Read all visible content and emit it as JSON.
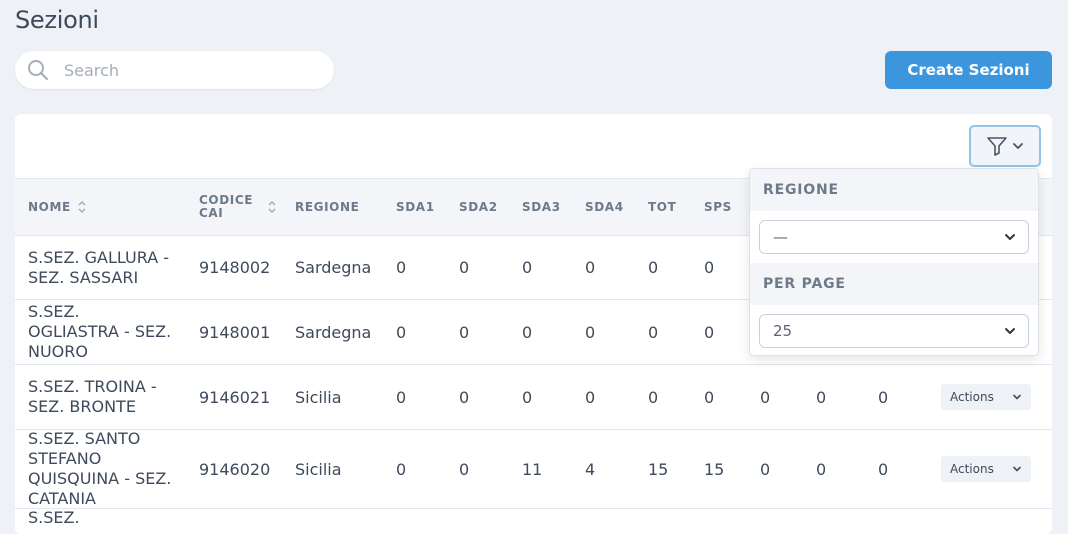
{
  "page": {
    "title": "Sezioni"
  },
  "search": {
    "placeholder": "Search",
    "value": ""
  },
  "toolbar": {
    "create_label": "Create Sezioni"
  },
  "table": {
    "columns": [
      "NOME",
      "CODICE CAI",
      "REGIONE",
      "SDA1",
      "SDA2",
      "SDA3",
      "SDA4",
      "TOT",
      "SPS"
    ],
    "codice_lines": [
      "CODICE",
      "CAI"
    ],
    "rows": [
      {
        "nome_lines": [
          "S.SEZ. GALLURA -",
          "SEZ. SASSARI"
        ],
        "codice": "9148002",
        "regione": "Sardegna",
        "sda1": "0",
        "sda2": "0",
        "sda3": "0",
        "sda4": "0",
        "tot": "0",
        "sps": "0",
        "c10": "",
        "c11": "",
        "c12": "",
        "actions": ""
      },
      {
        "nome_lines": [
          "S.SEZ.",
          "OGLIASTRA - SEZ.",
          "NUORO"
        ],
        "codice": "9148001",
        "regione": "Sardegna",
        "sda1": "0",
        "sda2": "0",
        "sda3": "0",
        "sda4": "0",
        "tot": "0",
        "sps": "0",
        "c10": "",
        "c11": "",
        "c12": "",
        "actions": ""
      },
      {
        "nome_lines": [
          "S.SEZ. TROINA -",
          "SEZ. BRONTE"
        ],
        "codice": "9146021",
        "regione": "Sicilia",
        "sda1": "0",
        "sda2": "0",
        "sda3": "0",
        "sda4": "0",
        "tot": "0",
        "sps": "0",
        "c10": "0",
        "c11": "0",
        "c12": "0",
        "actions": "Actions"
      },
      {
        "nome_lines": [
          "S.SEZ. SANTO",
          "STEFANO",
          "QUISQUINA - SEZ.",
          "CATANIA"
        ],
        "codice": "9146020",
        "regione": "Sicilia",
        "sda1": "0",
        "sda2": "0",
        "sda3": "11",
        "sda4": "4",
        "tot": "15",
        "sps": "15",
        "c10": "0",
        "c11": "0",
        "c12": "0",
        "actions": "Actions"
      },
      {
        "nome_lines": [
          "S.SEZ."
        ],
        "codice": "",
        "regione": "",
        "sda1": "",
        "sda2": "",
        "sda3": "",
        "sda4": "",
        "tot": "",
        "sps": "",
        "c10": "",
        "c11": "",
        "c12": "",
        "actions": ""
      }
    ]
  },
  "filter_panel": {
    "regione_label": "REGIONE",
    "regione_value": "—",
    "per_page_label": "PER PAGE",
    "per_page_value": "25"
  },
  "icons": {
    "search": "search-icon",
    "filter": "filter-icon",
    "chevron": "chevron-down-icon",
    "sort": "sort-icon"
  },
  "colors": {
    "accent": "#3b96dd",
    "background": "#eef1f5",
    "header_bg": "#f3f5f8"
  }
}
